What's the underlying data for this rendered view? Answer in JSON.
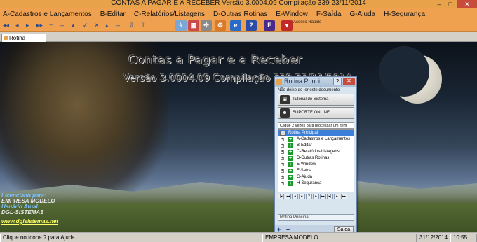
{
  "window": {
    "title": "CONTAS A PAGAR E A RECEBER  Versão   3.0004.09 Compilação 339  23/11/2014",
    "minimize": "–",
    "maximize": "□",
    "close": "✕"
  },
  "menu": [
    "A-Cadastros e Lançamentos",
    "B-Editar",
    "C-Relatórios/Listagens",
    "D-Outras Rotinas",
    "E-Window",
    "F-Saída",
    "G-Ajuda",
    "H-Segurança"
  ],
  "toolbar": {
    "nav_glyphs": [
      "◂◂",
      "◂",
      "▸",
      "▸▸",
      "+",
      "–",
      "▴",
      "✓",
      "✕",
      "▴",
      "–",
      "⇩",
      "⇧"
    ],
    "quick_access_label": "Acesso Rápido",
    "icons": [
      "calc-icon",
      "calendar-icon",
      "tools-icon",
      "settings-icon",
      "browser-icon",
      "help-icon",
      "f-app-icon",
      "mail-icon"
    ]
  },
  "tabs": [
    {
      "label": "Rotina Principal"
    }
  ],
  "main": {
    "app_title": "Contas a Pagar e a Receber",
    "app_version": "Versão    3.0004.09 Compilação 339  23/11/2014",
    "licensed_label": "Licenciado para:",
    "licensed_value": "EMPRESA MODELO",
    "user_label": "Usuário Atual:",
    "user_value": "DGL-SISTEMAS",
    "website": "www.dglsistemas.net"
  },
  "panel": {
    "title": "Rotina Princi...",
    "help": "?",
    "close": "✕",
    "note": "Não deixe de ler este documento",
    "tutorial_button": "Tutorial do Sistema",
    "support_button": "SUPORTE ONLINE",
    "hint": "Clique 2 vezes para processar um item",
    "tree_root": "Rotina Principal",
    "tree_items": [
      "A-Cadastros e Lançamentos",
      "B-Editar",
      "C-Relatórios/Listagens",
      "D-Outras Rotinas",
      "E-Window",
      "F-Saída",
      "G-Ajuda",
      "H-Segurança"
    ],
    "nav_buttons": [
      "|◂",
      "◂◂",
      "◂",
      "▸",
      "?",
      "▸",
      "▸▸",
      "▸|",
      "▸",
      "▸▸"
    ],
    "footer_label": "Rotina Principal",
    "plus": "+",
    "minus": "–",
    "exit_button": "Saída"
  },
  "statusbar": {
    "hint": "Clique no ícone ? para Ajuda",
    "company": "EMPRESA MODELO",
    "date": "31/12/2014",
    "time": "10:55"
  },
  "colors": {
    "titlebar": "#e8a24a",
    "menubar": "#f0a150",
    "close_red": "#c74c3c",
    "tree_selected": "#3c7fd9",
    "tree_plus": "#1a9a2a"
  }
}
